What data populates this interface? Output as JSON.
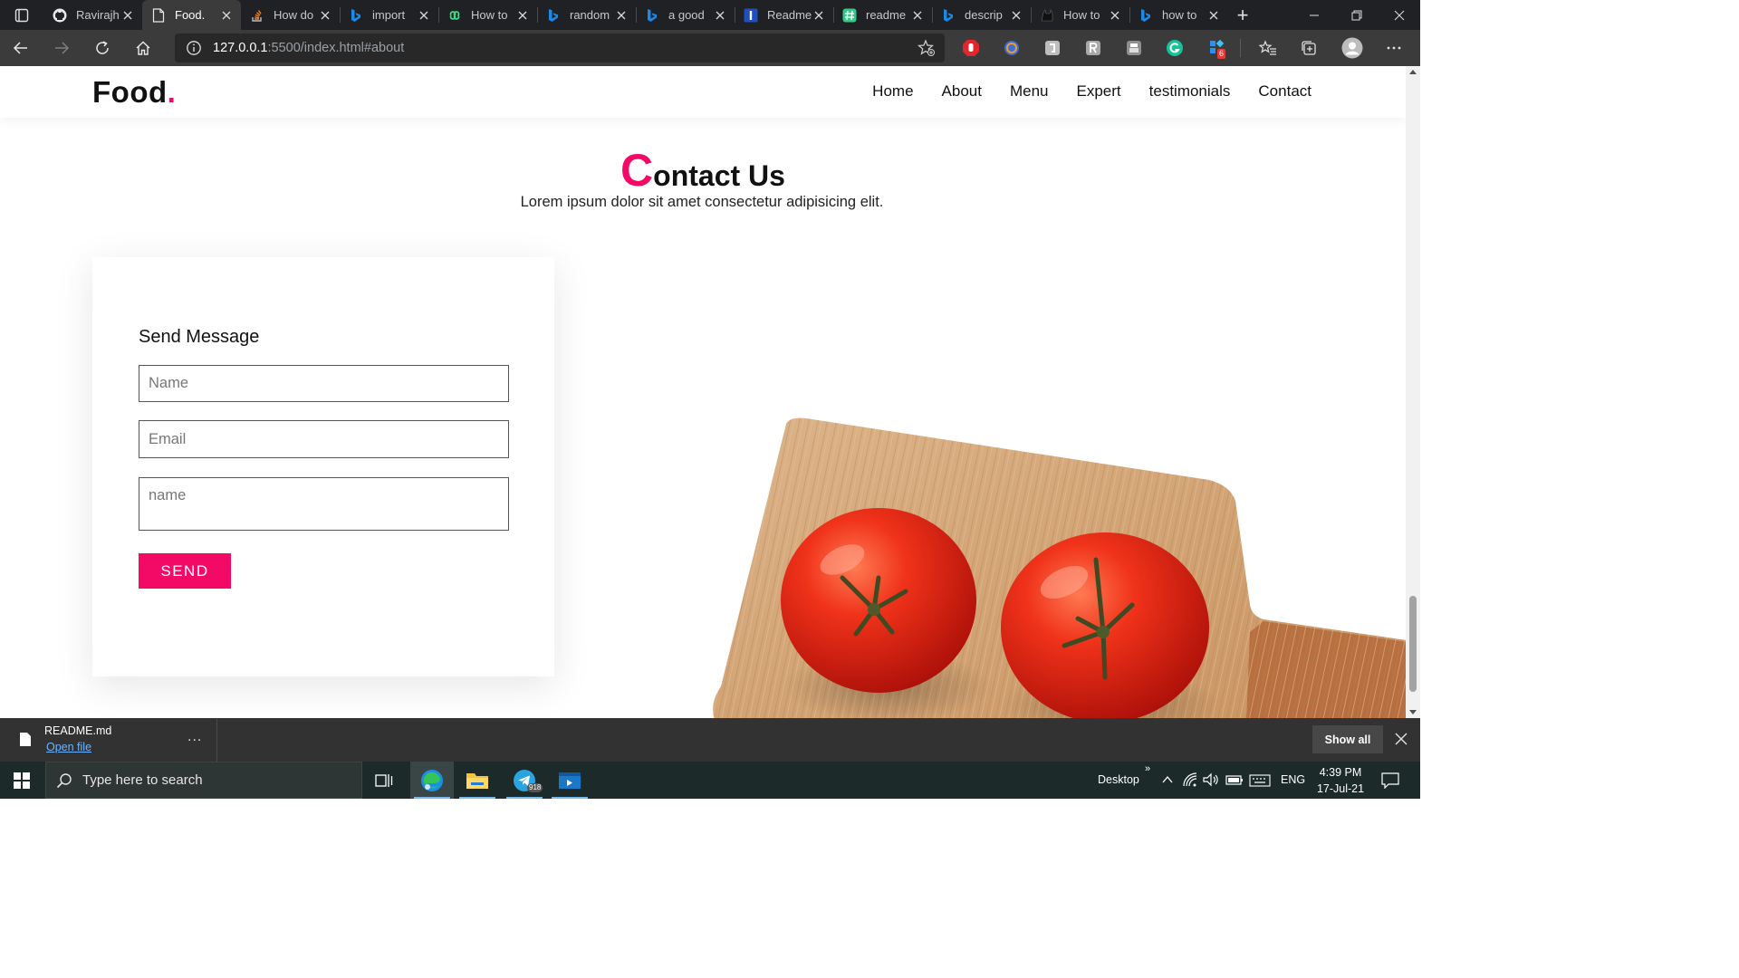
{
  "browser": {
    "tabs": [
      {
        "title": "Ravirajh",
        "icon": "github-icon",
        "active": false
      },
      {
        "title": "Food.",
        "icon": "page-icon",
        "active": true
      },
      {
        "title": "How do",
        "icon": "stackoverflow-icon",
        "active": false
      },
      {
        "title": "import",
        "icon": "bing-icon",
        "active": false
      },
      {
        "title": "How to",
        "icon": "infinity-icon",
        "active": false
      },
      {
        "title": "random",
        "icon": "bing-icon",
        "active": false
      },
      {
        "title": "a good",
        "icon": "bing-icon",
        "active": false
      },
      {
        "title": "Readme",
        "icon": "readme-icon",
        "active": false
      },
      {
        "title": "readme",
        "icon": "hash-icon",
        "active": false
      },
      {
        "title": "descrip",
        "icon": "bing-icon",
        "active": false
      },
      {
        "title": "How to",
        "icon": "cat-icon",
        "active": false
      },
      {
        "title": "how to",
        "icon": "bing-icon",
        "active": false
      }
    ],
    "url_host": "127.0.0.1",
    "url_rest": ":5500/index.html#about",
    "extension_badge": "6"
  },
  "site": {
    "logo_text": "Food",
    "logo_dot": ".",
    "nav": [
      "Home",
      "About",
      "Menu",
      "Expert",
      "testimonials",
      "Contact"
    ],
    "accent_color": "#f30a67"
  },
  "contact": {
    "title_cap": "C",
    "title_rest": "ontact Us",
    "subtitle": "Lorem ipsum dolor sit amet consectetur adipisicing elit.",
    "form_heading": "Send Message",
    "name_placeholder": "Name",
    "email_placeholder": "Email",
    "message_placeholder": "name",
    "send_label": "SEND"
  },
  "download_bar": {
    "file_name": "README.md",
    "open_label": "Open file",
    "more_label": "...",
    "show_all_label": "Show all"
  },
  "taskbar": {
    "search_placeholder": "Type here to search",
    "desktop_label": "Desktop",
    "language": "ENG",
    "time": "4:39 PM",
    "date": "17-Jul-21",
    "telegram_badge": "918"
  }
}
